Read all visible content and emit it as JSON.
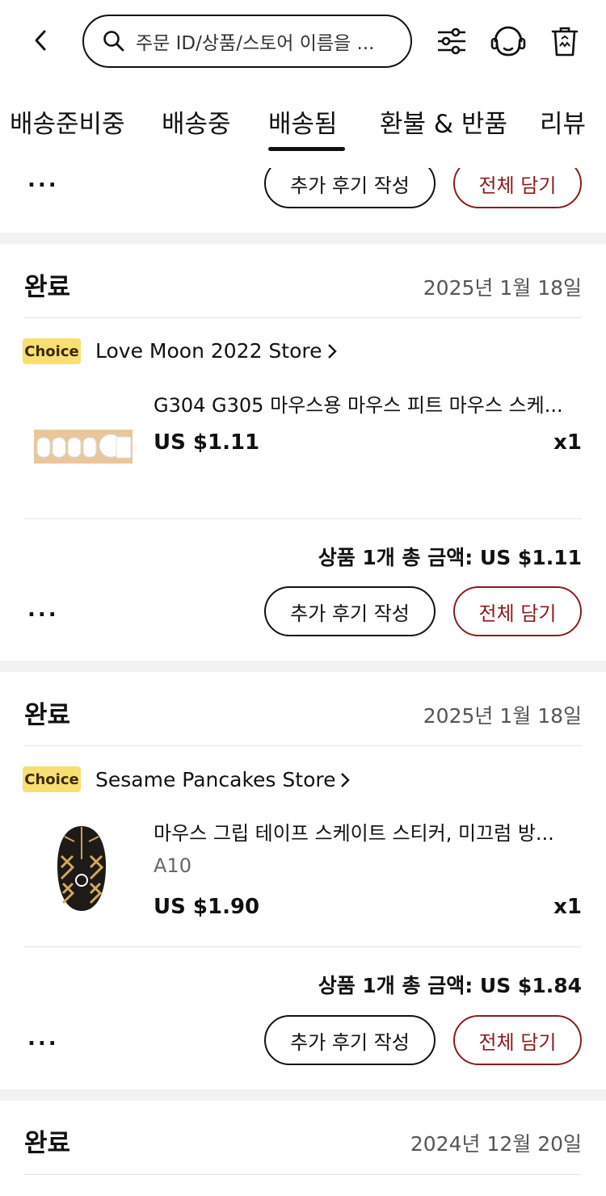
{
  "header": {
    "search_placeholder": "주문 ID/상품/스토어 이름을 ...",
    "icons": [
      "back-icon",
      "search-icon",
      "filter-icon",
      "support-icon",
      "delete-icon"
    ]
  },
  "tabs": [
    {
      "label": "배송준비중",
      "active": false
    },
    {
      "label": "배송중",
      "active": false
    },
    {
      "label": "배송됨",
      "active": true
    },
    {
      "label": "환불 & 반품",
      "active": false
    },
    {
      "label": "리뷰",
      "active": false
    }
  ],
  "actions": {
    "more": "...",
    "review_label": "추가 후기 작성",
    "add_all_label": "전체 담기"
  },
  "orders": [
    {
      "status": "완료",
      "date": "2025년 1월 18일",
      "badge": "Choice",
      "store": "Love Moon 2022 Store",
      "item_title": "G304 G305 마우스용 마우스 피트 마우스 스케...",
      "price": "US $1.11",
      "qty": "x1",
      "total": "상품 1개 총 금액: US $1.11"
    },
    {
      "status": "완료",
      "date": "2025년 1월 18일",
      "badge": "Choice",
      "store": "Sesame Pancakes Store",
      "item_title": "마우스 그립 테이프 스케이트 스티커, 미끄럼 방...",
      "variant": "A10",
      "price": "US $1.90",
      "qty": "x1",
      "total": "상품 1개 총 금액: US $1.84"
    },
    {
      "status": "완료",
      "date": "2024년 12월 20일"
    }
  ],
  "colors": {
    "accent": "#8a1c1c",
    "choice_badge": "#f7df72",
    "separator": "#f2f2f2"
  }
}
